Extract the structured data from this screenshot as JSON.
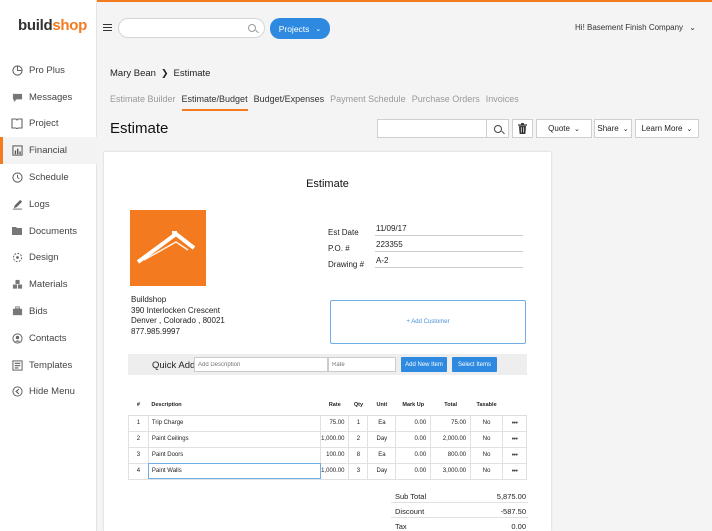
{
  "brand": {
    "logo_build": "build",
    "logo_shop": "shop",
    "accent": "#f47b20",
    "primary": "#2d8ae0"
  },
  "sidebar": {
    "items": [
      {
        "label": "Pro Plus",
        "icon": "pie-chart-icon"
      },
      {
        "label": "Messages",
        "icon": "chat-bubble-icon"
      },
      {
        "label": "Project",
        "icon": "book-icon"
      },
      {
        "label": "Financial",
        "icon": "chart-icon"
      },
      {
        "label": "Schedule",
        "icon": "clock-icon"
      },
      {
        "label": "Logs",
        "icon": "pencil-icon"
      },
      {
        "label": "Documents",
        "icon": "folder-icon"
      },
      {
        "label": "Design",
        "icon": "design-icon"
      },
      {
        "label": "Materials",
        "icon": "boxes-icon"
      },
      {
        "label": "Bids",
        "icon": "bids-icon"
      },
      {
        "label": "Contacts",
        "icon": "contacts-icon"
      },
      {
        "label": "Templates",
        "icon": "templates-icon"
      },
      {
        "label": "Hide Menu",
        "icon": "arrow-left-circle-icon"
      }
    ],
    "active": "Financial"
  },
  "header": {
    "search_value": "",
    "projects_label": "Projects",
    "company": "Hi! Basement Finish Company"
  },
  "breadcrumb": {
    "parent": "Mary Bean",
    "current": "Estimate"
  },
  "tabs": [
    {
      "label": "Estimate Builder"
    },
    {
      "label": "Estimate/Budget",
      "active": true
    },
    {
      "label": "Budget/Expenses"
    },
    {
      "label": "Payment Schedule"
    },
    {
      "label": "Purchase Orders"
    },
    {
      "label": "Invoices"
    }
  ],
  "page_title": "Estimate",
  "toolbar": {
    "quote": "Quote",
    "share": "Share",
    "learn_more": "Learn More"
  },
  "doc": {
    "title": "Estimate",
    "meta": {
      "est_date_label": "Est Date",
      "est_date": "11/09/17",
      "po_label": "P.O. #",
      "po": "223355",
      "drawing_label": "Drawing #",
      "drawing": "A-2"
    },
    "address": {
      "name": "Buildshop",
      "street": "390 Interlocken Crescent",
      "city": "Denver , Colorado , 80021",
      "phone": "877.985.9997"
    },
    "add_customer": "+ Add Customer",
    "quick_add": {
      "label": "Quick Add",
      "desc_placeholder": "Add Description",
      "rate_placeholder": "Rate",
      "add_new": "Add New Item",
      "select": "Select Items"
    },
    "columns": [
      "#",
      "Description",
      "Rate",
      "Qty",
      "Unit",
      "Mark Up",
      "Total",
      "Taxable"
    ],
    "rows": [
      {
        "n": "1",
        "desc": "Trip Charge",
        "rate": "75.00",
        "qty": "1",
        "unit": "Ea",
        "markup": "0.00",
        "total": "75.00",
        "taxable": "No"
      },
      {
        "n": "2",
        "desc": "Paint Ceilings",
        "rate": "1,000.00",
        "qty": "2",
        "unit": "Day",
        "markup": "0.00",
        "total": "2,000.00",
        "taxable": "No"
      },
      {
        "n": "3",
        "desc": "Paint Doors",
        "rate": "100.00",
        "qty": "8",
        "unit": "Ea",
        "markup": "0.00",
        "total": "800.00",
        "taxable": "No"
      },
      {
        "n": "4",
        "desc": "Paint Walls",
        "rate": "1,000.00",
        "qty": "3",
        "unit": "Day",
        "markup": "0.00",
        "total": "3,000.00",
        "taxable": "No"
      }
    ],
    "row_menu": "•••",
    "totals": [
      {
        "label": "Sub Total",
        "value": "5,875.00"
      },
      {
        "label": "Discount",
        "value": "-587.50"
      },
      {
        "label": "Tax",
        "value": "0.00"
      }
    ]
  }
}
